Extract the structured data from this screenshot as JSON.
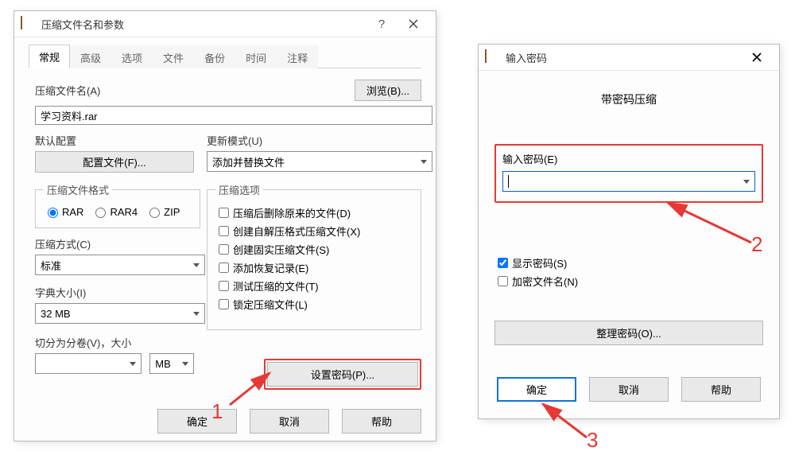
{
  "main": {
    "title": "压缩文件名和参数",
    "tabs": [
      "常规",
      "高级",
      "选项",
      "文件",
      "备份",
      "时间",
      "注释"
    ],
    "archive_name_label": "压缩文件名(A)",
    "browse_button": "浏览(B)...",
    "archive_name_value": "学习资料.rar",
    "default_cfg_label": "默认配置",
    "cfg_button": "配置文件(F)...",
    "update_mode_label": "更新模式(U)",
    "update_mode_value": "添加并替换文件",
    "format_legend": "压缩文件格式",
    "formats": [
      "RAR",
      "RAR4",
      "ZIP"
    ],
    "method_label": "压缩方式(C)",
    "method_value": "标准",
    "dict_label": "字典大小(I)",
    "dict_value": "32 MB",
    "split_label": "切分为分卷(V)，大小",
    "split_value": "",
    "split_unit": "MB",
    "options_legend": "压缩选项",
    "options": [
      "压缩后删除原来的文件(D)",
      "创建自解压格式压缩文件(X)",
      "创建固实压缩文件(S)",
      "添加恢复记录(E)",
      "测试压缩的文件(T)",
      "锁定压缩文件(L)"
    ],
    "set_password_button": "设置密码(P)...",
    "ok": "确定",
    "cancel": "取消",
    "help": "帮助"
  },
  "pwd": {
    "title": "输入密码",
    "subhead": "带密码压缩",
    "input_label": "输入密码(E)",
    "input_value": "",
    "show_pwd": "显示密码(S)",
    "encrypt_names": "加密文件名(N)",
    "manage_button": "整理密码(O)...",
    "ok": "确定",
    "cancel": "取消",
    "help": "帮助"
  },
  "annot": {
    "n1": "1",
    "n2": "2",
    "n3": "3"
  },
  "colors": {
    "highlight": "#e53935",
    "focus_blue": "#0a5fbd"
  }
}
